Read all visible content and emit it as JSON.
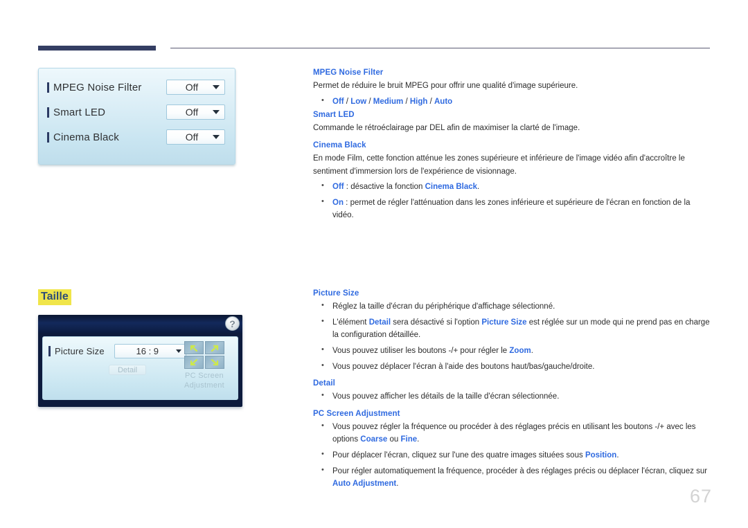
{
  "page": {
    "number": "67"
  },
  "osd_picture_panel": {
    "rows": [
      {
        "label": "MPEG Noise Filter",
        "value": "Off"
      },
      {
        "label": "Smart LED",
        "value": "Off"
      },
      {
        "label": "Cinema Black",
        "value": "Off"
      }
    ]
  },
  "section": {
    "heading": "Taille"
  },
  "osd_size_panel": {
    "help_label": "?",
    "picture_size_label": "Picture Size",
    "picture_size_value": "16 : 9",
    "detail_button": "Detail",
    "pc_screen_adjustment_label": "PC Screen\nAdjustment"
  },
  "doc_top": {
    "mpeg_noise_filter": {
      "heading": "MPEG Noise Filter",
      "paragraph": "Permet de réduire le bruit MPEG pour offrir une qualité d'image supérieure.",
      "options": [
        "Off",
        "Low",
        "Medium",
        "High",
        "Auto"
      ],
      "options_separator": " / "
    },
    "smart_led": {
      "heading": "Smart LED",
      "paragraph": "Commande le rétroéclairage par DEL afin de maximiser la clarté de l'image."
    },
    "cinema_black": {
      "heading": "Cinema Black",
      "paragraph": "En mode Film, cette fonction atténue les zones supérieure et inférieure de l'image vidéo afin d'accroître le sentiment d'immersion lors de l'expérience de visionnage.",
      "bullet_off_key": "Off",
      "bullet_off_text_1": " : désactive la fonction ",
      "bullet_off_ref": "Cinema Black",
      "bullet_off_text_2": ".",
      "bullet_on_key": "On",
      "bullet_on_text": " : permet de régler l'atténuation dans les zones inférieure et supérieure de l'écran en fonction de la vidéo."
    }
  },
  "doc_bottom": {
    "picture_size": {
      "heading": "Picture Size",
      "b1": "Réglez la taille d'écran du périphérique d'affichage sélectionné.",
      "b2_t1": "L'élément ",
      "b2_k1": "Detail",
      "b2_t2": " sera désactivé si l'option ",
      "b2_k2": "Picture Size",
      "b2_t3": " est réglée sur un mode qui ne prend pas en charge la configuration détaillée.",
      "b3_t1": "Vous pouvez utiliser les boutons -/+ pour régler le ",
      "b3_k1": "Zoom",
      "b3_t2": ".",
      "b4": "Vous pouvez déplacer l'écran à l'aide des boutons haut/bas/gauche/droite."
    },
    "detail": {
      "heading": "Detail",
      "b1": "Vous pouvez afficher les détails de la taille d'écran sélectionnée."
    },
    "pc_screen_adjustment": {
      "heading": "PC Screen Adjustment",
      "b1_t1": "Vous pouvez régler la fréquence ou procéder à des réglages précis en utilisant les boutons -/+ avec les options ",
      "b1_k1": "Coarse",
      "b1_t2": " ou ",
      "b1_k2": "Fine",
      "b1_t3": ".",
      "b2_t1": "Pour déplacer l'écran, cliquez sur l'une des quatre images situées sous ",
      "b2_k1": "Position",
      "b2_t2": ".",
      "b3_t1": "Pour régler automatiquement la fréquence, procéder à des réglages précis ou déplacer l'écran, cliquez sur ",
      "b3_k1": "Auto Adjustment",
      "b3_t2": "."
    }
  },
  "colors": {
    "accent_blue": "#2f6ae0",
    "heading_navy": "#2e4c78",
    "highlight_yellow": "#f0e54a",
    "rule_navy": "#343e63",
    "page_number_gray": "#d3d3d3"
  }
}
